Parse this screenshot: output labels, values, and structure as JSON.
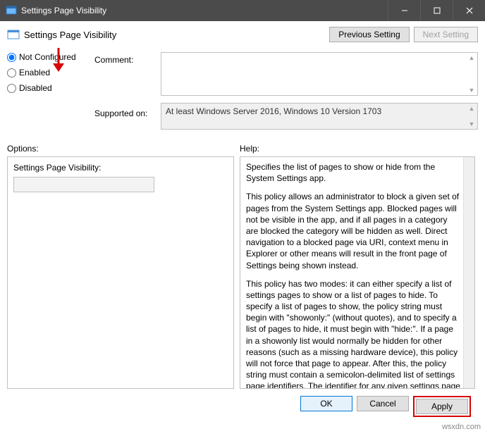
{
  "window": {
    "title": "Settings Page Visibility"
  },
  "header": {
    "title": "Settings Page Visibility",
    "prev_btn": "Previous Setting",
    "next_btn": "Next Setting"
  },
  "radios": {
    "not_configured": "Not Configured",
    "enabled": "Enabled",
    "disabled": "Disabled",
    "selected": "not_configured"
  },
  "labels": {
    "comment": "Comment:",
    "supported": "Supported on:",
    "options": "Options:",
    "help": "Help:"
  },
  "supported_text": "At least Windows Server 2016, Windows 10 Version 1703",
  "options_panel": {
    "field_label": "Settings Page Visibility:",
    "field_value": ""
  },
  "help": {
    "p1": "Specifies the list of pages to show or hide from the System Settings app.",
    "p2": "This policy allows an administrator to block a given set of pages from the System Settings app. Blocked pages will not be visible in the app, and if all pages in a category are blocked the category will be hidden as well. Direct navigation to a blocked page via URI, context menu in Explorer or other means will result in the front page of Settings being shown instead.",
    "p3": "This policy has two modes: it can either specify a list of settings pages to show or a list of pages to hide. To specify a list of pages to show, the policy string must begin with \"showonly:\" (without quotes), and to specify a list of pages to hide, it must begin with \"hide:\". If a page in a showonly list would normally be hidden for other reasons (such as a missing hardware device), this policy will not force that page to appear. After this, the policy string must contain a semicolon-delimited list of settings page identifiers. The identifier for any given settings page is the published URI for that page, minus the \"ms-settings:\" protocol part."
  },
  "footer": {
    "ok": "OK",
    "cancel": "Cancel",
    "apply": "Apply"
  },
  "watermark": "wsxdn.com"
}
